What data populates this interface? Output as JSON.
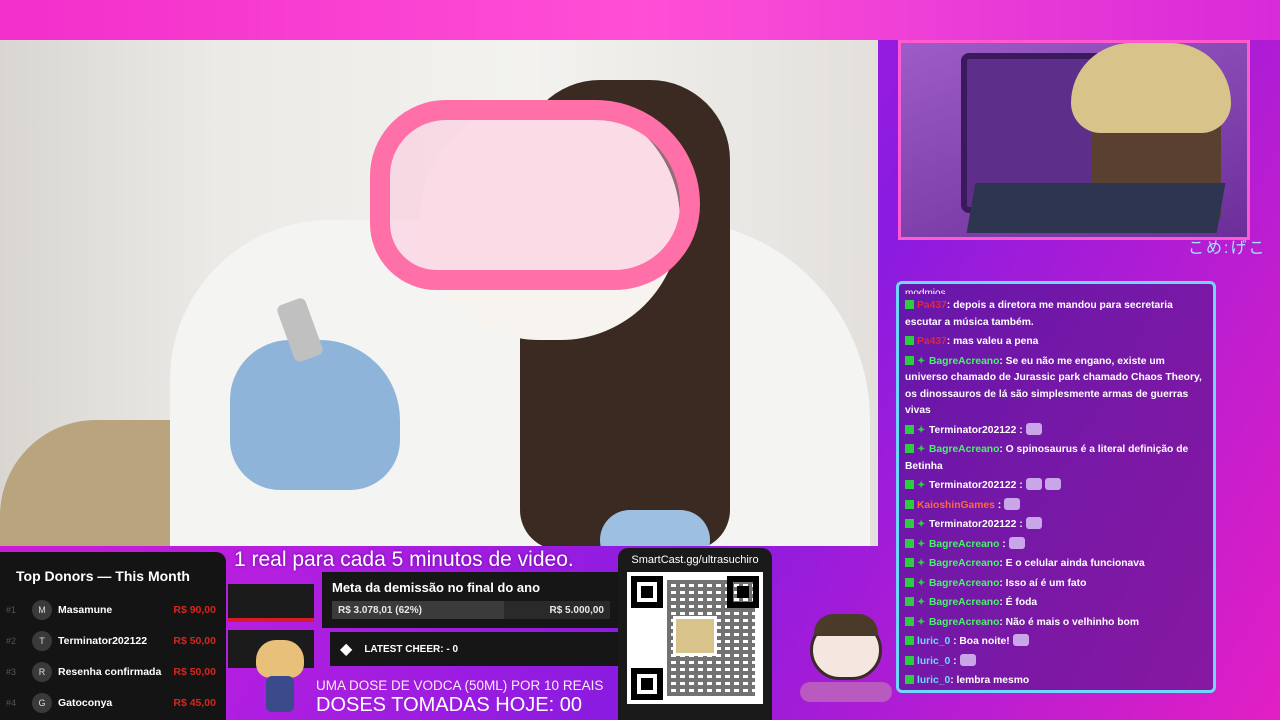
{
  "colors": {
    "accent_pink": "#ff5ad0",
    "chat_border": "#6fd7ff",
    "donor_amount": "#d8251e"
  },
  "video": {
    "caption": "1 real para cada 5 minutos de video."
  },
  "webcam": {
    "caption": "こめ:げこ"
  },
  "chat": {
    "cut_line": "modmios",
    "messages": [
      {
        "user": "Pa437",
        "user_color": "#e2283a",
        "text": ": depois a diretora me mandou para secretaria escutar a música também.",
        "badges": 1,
        "emotes": 0
      },
      {
        "user": "Pa437",
        "user_color": "#e2283a",
        "text": ": mas valeu a pena",
        "badges": 1,
        "emotes": 0
      },
      {
        "user": "BagreAcreano",
        "user_color": "#49f26b",
        "text": ": Se eu não me engano, existe um universo chamado de Jurassic park chamado Chaos Theory, os dinossauros de lá são simplesmente armas de guerras vivas",
        "badges": 2,
        "emotes": 0
      },
      {
        "user": "Terminator202122",
        "user_color": "#ffffff",
        "text": " :",
        "badges": 2,
        "emotes": 1
      },
      {
        "user": "BagreAcreano",
        "user_color": "#49f26b",
        "text": ": O spinosaurus é a literal definição de Betinha",
        "badges": 2,
        "emotes": 0
      },
      {
        "user": "Terminator202122",
        "user_color": "#ffffff",
        "text": " :",
        "badges": 2,
        "emotes": 2
      },
      {
        "user": "KaioshinGames",
        "user_color": "#ff6a3c",
        "text": " :",
        "badges": 1,
        "emotes": 1
      },
      {
        "user": "Terminator202122",
        "user_color": "#ffffff",
        "text": " :",
        "badges": 2,
        "emotes": 1
      },
      {
        "user": "BagreAcreano",
        "user_color": "#49f26b",
        "text": " :",
        "badges": 2,
        "emotes": 1
      },
      {
        "user": "BagreAcreano",
        "user_color": "#49f26b",
        "text": ": E o celular ainda funcionava",
        "badges": 2,
        "emotes": 0
      },
      {
        "user": "BagreAcreano",
        "user_color": "#49f26b",
        "text": ": Isso aí é um fato",
        "badges": 2,
        "emotes": 0
      },
      {
        "user": "BagreAcreano",
        "user_color": "#49f26b",
        "text": ": É foda",
        "badges": 2,
        "emotes": 0
      },
      {
        "user": "BagreAcreano",
        "user_color": "#49f26b",
        "text": ": Não é mais o velhinho bom",
        "badges": 2,
        "emotes": 0
      },
      {
        "user": "luric_0",
        "user_color": "#6fd7ff",
        "text": " : Boa noite!",
        "badges": 1,
        "emotes": 1
      },
      {
        "user": "luric_0",
        "user_color": "#6fd7ff",
        "text": " :",
        "badges": 1,
        "emotes": 1
      },
      {
        "user": "luric_0",
        "user_color": "#6fd7ff",
        "text": ": lembra mesmo",
        "badges": 1,
        "emotes": 0
      }
    ]
  },
  "donors": {
    "title": "Top Donors — This Month",
    "rows": [
      {
        "rank": "#1",
        "initial": "M",
        "name": "Masamune",
        "amount": "R$ 90,00"
      },
      {
        "rank": "#2",
        "initial": "T",
        "name": "Terminator202122",
        "amount": "R$ 50,00"
      },
      {
        "rank": "#3",
        "initial": "R",
        "name": "Resenha confirmada",
        "amount": "R$ 50,00"
      },
      {
        "rank": "#4",
        "initial": "G",
        "name": "Gatoconya",
        "amount": "R$ 45,00"
      }
    ]
  },
  "goal": {
    "title": "Meta da demissão no final do ano",
    "current": "R$ 3.078,01 (62%)",
    "target": "R$ 5.000,00",
    "progress": 0.62
  },
  "cheer": {
    "icon": "diamond-icon",
    "label": "LATEST CHEER:  - 0"
  },
  "vodka": {
    "line1": "UMA DOSE DE VODCA (50ML) POR 10 REAIS",
    "line2": "DOSES TOMADAS HOJE: 00"
  },
  "qr": {
    "label": "SmartCast.gg/ultrasuchiro"
  }
}
